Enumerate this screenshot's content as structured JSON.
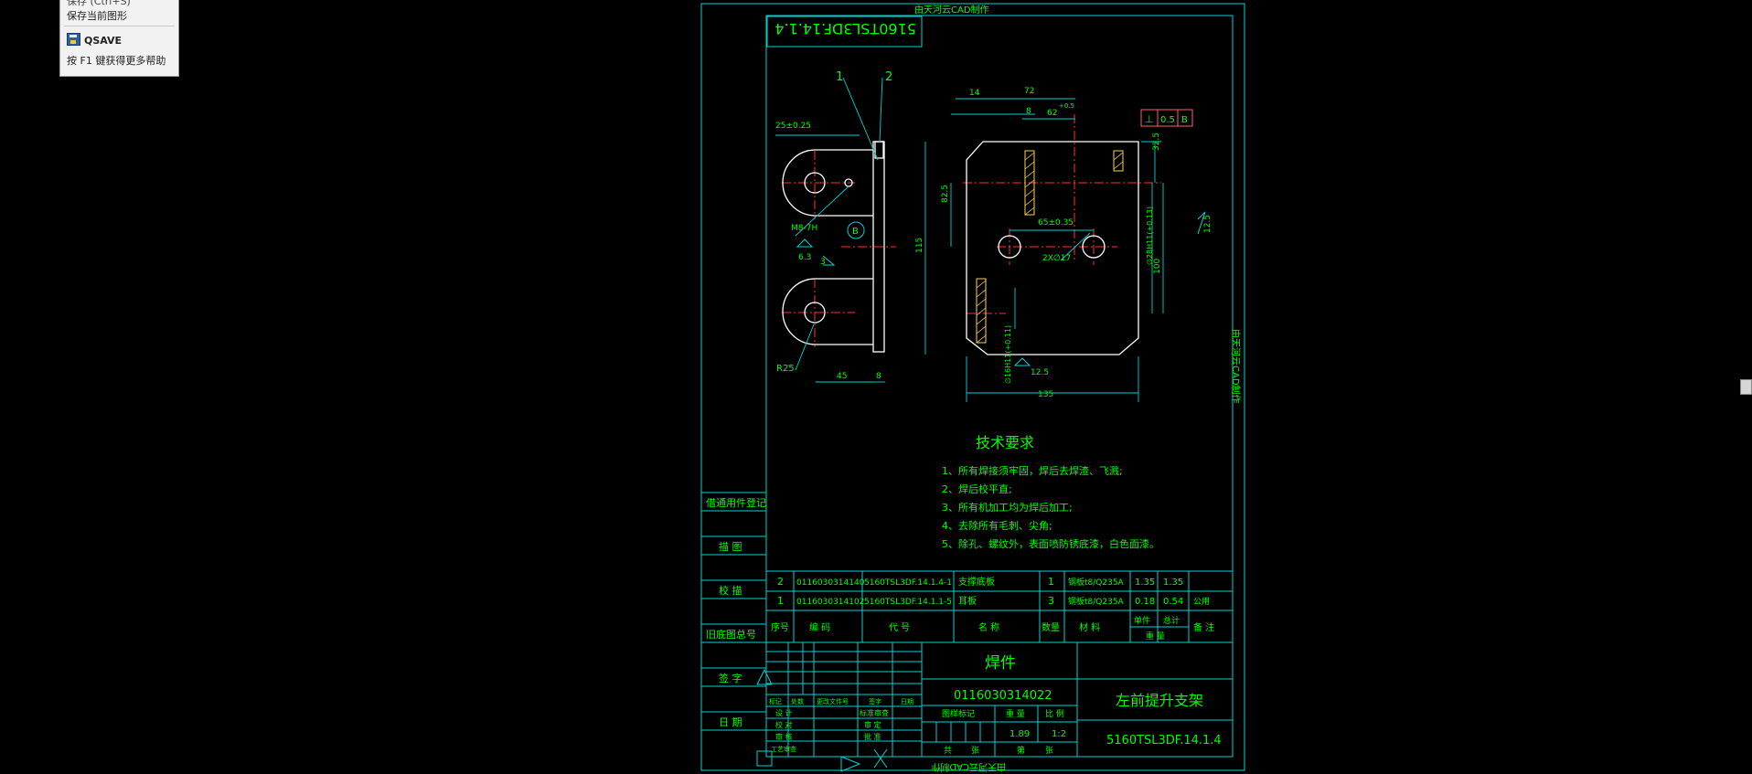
{
  "tooltip": {
    "partial_top": "保存 (Ctrl+S)",
    "description": "保存当前图形",
    "command": "QSAVE",
    "help": "按 F1 键获得更多帮助"
  },
  "watermark": {
    "top": "由天河云CAD制作",
    "right": "由天河云CAD制作",
    "bottom": "由天河云CAD制作"
  },
  "drawing_code": "5160TSL3DF.14.1.4",
  "balloons": [
    "1",
    "2"
  ],
  "dims": {
    "d1": "25±0.25",
    "d2": "14",
    "d3": "72",
    "d4": "8",
    "d5": "62",
    "d5_tol": "+0.5",
    "d6": "32.5",
    "d7": "82.5",
    "d8": "115",
    "d9": "65±0.35",
    "d10": "2X∅17",
    "d11": "∅28H11(+0.13)",
    "d12": "100",
    "d13": "∅16H11(+0.11)",
    "d14": "135",
    "d15": "45",
    "d16": "8",
    "thread": "M8-7H",
    "rough1": "6.3",
    "rough2": "12.5",
    "rough3": "12.5",
    "radius": "R25",
    "datum": "B",
    "gtol": [
      "⊥",
      "0.5",
      "B"
    ],
    "weld": "3"
  },
  "tech": {
    "title": "技术要求",
    "items": [
      "1、所有焊接须牢固，焊后去焊渣、飞溅;",
      "2、焊后校平直;",
      "3、所有机加工均为焊后加工;",
      "4、去除所有毛刺、尖角;",
      "5、除孔、螺纹外，表面喷防锈底漆，白色面漆。"
    ]
  },
  "side_labels": [
    "借通用件登记",
    "描 图",
    "校 描",
    "旧底图总号",
    "签 字",
    "日 期"
  ],
  "bom": {
    "rows": [
      [
        "2",
        "0116030314140",
        "5160TSL3DF.14.1.4-1",
        "支撑底板",
        "1",
        "钢板t8/Q235A",
        "1.35",
        "1.35",
        ""
      ],
      [
        "1",
        "0116030314102",
        "5160TSL3DF.14.1.1-5",
        "耳板",
        "3",
        "钢板t8/Q235A",
        "0.18",
        "0.54",
        "公用"
      ]
    ],
    "header": [
      "序号",
      "编 码",
      "代 号",
      "名 称",
      "数量",
      "材 料",
      "单件",
      "总计",
      "备 注"
    ],
    "weight_label": "重 量"
  },
  "title_block": {
    "type": "焊件",
    "code": "0116030314022",
    "name": "左前提升支架",
    "drawing_no": "5160TSL3DF.14.1.4",
    "weight": "1.89",
    "scale": "1:2",
    "revision_labels": [
      "标记",
      "处数",
      "更改文件号",
      "签字",
      "日期"
    ],
    "roles": [
      "设 计",
      "校 对",
      "审 核",
      "工艺审查"
    ],
    "roles2": [
      "标准审查",
      "审 定",
      "批 准"
    ],
    "stage_label": "图样标记",
    "weight_label": "重 量",
    "scale_label": "比 例",
    "sheet_labels": [
      "共",
      "张",
      "第",
      "张"
    ]
  },
  "colors": {
    "frame": "#00d2d2",
    "text": "#00ff00",
    "center": "#ff3030",
    "geom": "#ffffff",
    "hatch": "#ffd24a",
    "gtol_box": "#ff6060"
  }
}
